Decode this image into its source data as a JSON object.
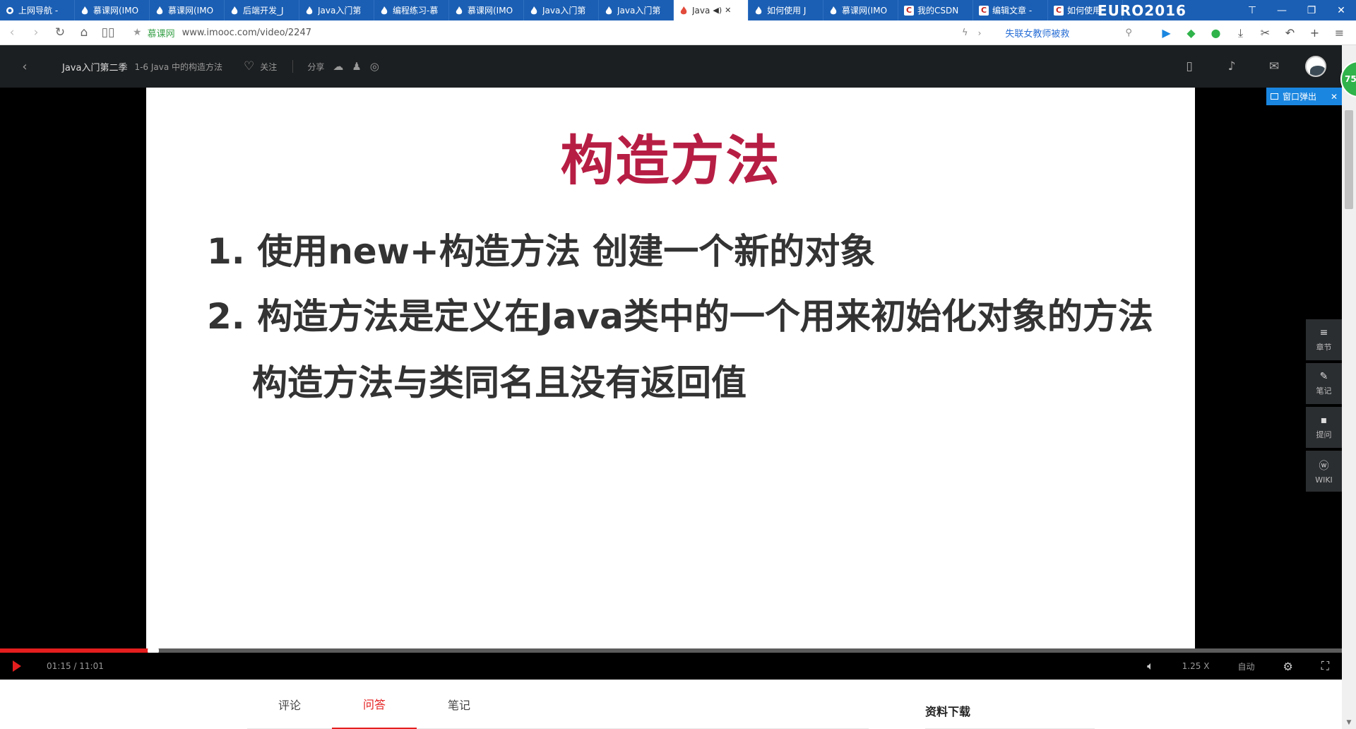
{
  "browser": {
    "tabs": [
      {
        "label": "上网导航 -",
        "icon": "browser-logo-icon"
      },
      {
        "label": "慕课网(IMO",
        "icon": "flame-icon"
      },
      {
        "label": "慕课网(IMO",
        "icon": "flame-icon"
      },
      {
        "label": "后端开发_J",
        "icon": "flame-icon"
      },
      {
        "label": "Java入门第",
        "icon": "flame-icon"
      },
      {
        "label": "编程练习-慕",
        "icon": "flame-icon"
      },
      {
        "label": "慕课网(IMO",
        "icon": "flame-icon"
      },
      {
        "label": "Java入门第",
        "icon": "flame-icon"
      },
      {
        "label": "Java入门第",
        "icon": "flame-icon"
      },
      {
        "label": "Java",
        "icon": "flame-icon",
        "active": true
      },
      {
        "label": "如何使用 J",
        "icon": "flame-icon"
      },
      {
        "label": "慕课网(IMO",
        "icon": "flame-icon"
      },
      {
        "label": "我的CSDN",
        "icon": "csdn-icon"
      },
      {
        "label": "编辑文章 -",
        "icon": "csdn-icon"
      },
      {
        "label": "如何使用",
        "icon": "csdn-icon"
      }
    ],
    "banner": "EURO2016",
    "site_name": "慕课网",
    "url": "www.imooc.com/video/2247",
    "search_hint": "失联女教师被救"
  },
  "header": {
    "course_title": "Java入门第二季",
    "lesson_title": "1-6 Java 中的构造方法",
    "follow_label": "关注",
    "share_label": "分享"
  },
  "player": {
    "popup_label": "窗口弹出",
    "slide": {
      "title": "构造方法",
      "line1": "1. 使用new+构造方法 创建一个新的对象",
      "line2": "2. 构造方法是定义在Java类中的一个用来初始化对象的方法",
      "line3": "构造方法与类同名且没有返回值"
    },
    "side_tools": [
      {
        "label": "章节",
        "icon": "menu-icon"
      },
      {
        "label": "笔记",
        "icon": "pencil-icon"
      },
      {
        "label": "提问",
        "icon": "question-icon"
      },
      {
        "label": "WIKI",
        "icon": "wiki-icon"
      }
    ],
    "progress": 0.114,
    "time": "01:15 / 11:01",
    "speed": "1.25 X",
    "quality": "自动",
    "speed_badge": "75"
  },
  "content": {
    "tabs": [
      {
        "label": "评论"
      },
      {
        "label": "问答",
        "active": true
      },
      {
        "label": "笔记"
      }
    ],
    "resources_title": "资料下载"
  },
  "colors": {
    "accent": "#e41e1e",
    "slide_title": "#b71e44",
    "tab_bar": "#1b5fb4",
    "popup": "#1a86e0"
  }
}
